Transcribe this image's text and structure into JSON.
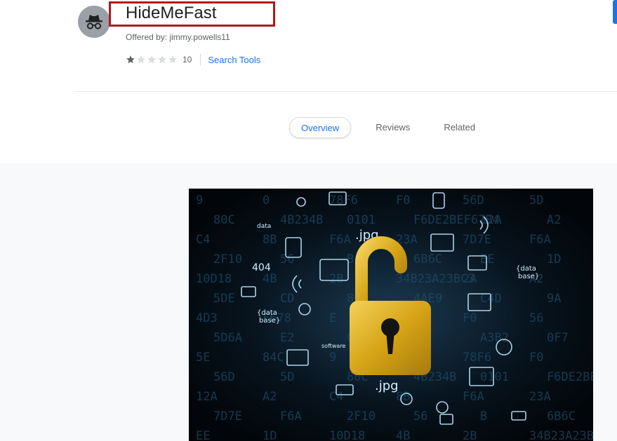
{
  "header": {
    "title": "HideMeFast",
    "offered_by": "Offered by: jimmy.powells11",
    "rating": 1,
    "rating_max": 5,
    "rating_count": "10",
    "category": "Search Tools",
    "avatar_icon": "incognito-icon"
  },
  "tabs": [
    {
      "label": "Overview",
      "active": true
    },
    {
      "label": "Reviews",
      "active": false
    },
    {
      "label": "Related",
      "active": false
    }
  ],
  "screenshot": {
    "icon": "unlocked-padlock-icon",
    "texts": [
      ".jpg",
      ".jpg",
      "404",
      "data",
      "{data\nbase}",
      "{data\nbase}",
      "software"
    ],
    "hex": "9 0 78F6 F0 56D 5D 80C 4B234B 0101 F6DE2BEF67B4 12A A2 C4 8B F6A 23A 7D7E F6A 2F10 56 B 6B6C EE 1D 10D18 4B 2B 34B23A23BC3 2A A2 5DE CD 8C 4AE9 C4D 9A 4D3 F678 E 78 F0 56 5D6A E2 C4 8B A3B2 0F7 5E 84C"
  },
  "colors": {
    "accent": "#1a73e8",
    "highlight_box": "#b0181c",
    "star_filled": "#5f6368",
    "star_empty": "#dadce0",
    "lock": "#e3b21e"
  }
}
